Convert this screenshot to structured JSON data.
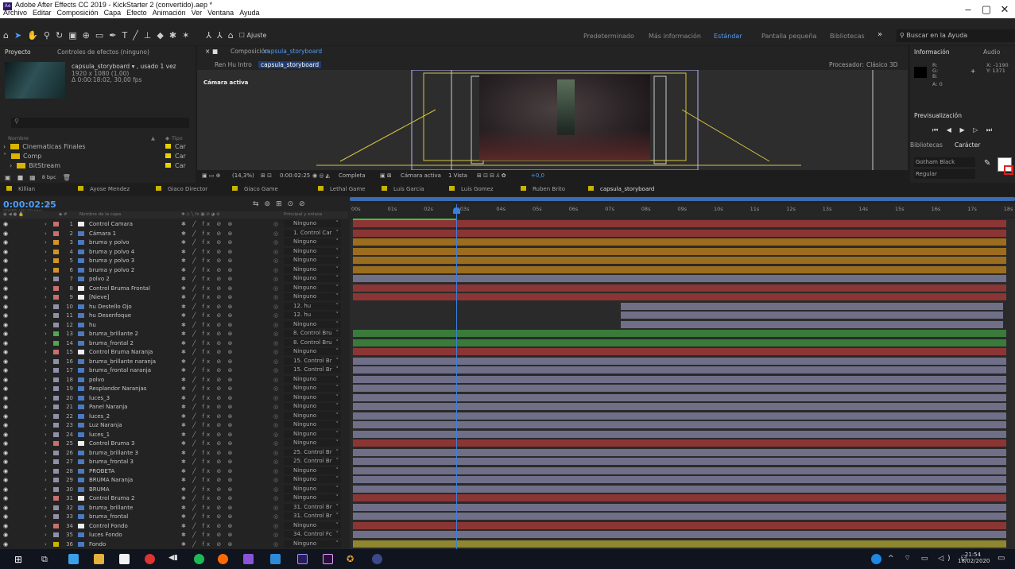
{
  "window": {
    "title": "Adobe After Effects CC 2019 - KickStarter 2 (convertido).aep *",
    "app_badge": "Ae",
    "menu": [
      "Archivo",
      "Editar",
      "Composición",
      "Capa",
      "Efecto",
      "Animación",
      "Ver",
      "Ventana",
      "Ayuda"
    ],
    "controls": {
      "minimize": "–",
      "maximize": "▢",
      "close": "✕"
    }
  },
  "toolbar": {
    "snap_label": "Ajuste",
    "workspaces": [
      "Predeterminado",
      "Más información",
      "Estándar",
      "Pantalla pequeña",
      "Bibliotecas"
    ],
    "active_workspace": "Estándar",
    "more": "»",
    "search_placeholder": "Buscar en la Ayuda"
  },
  "project_panel": {
    "tab1": "Proyecto",
    "tab2": "Controles de efectos (ninguno)",
    "item_name": "capsula_storyboard ▾ , usado 1 vez",
    "item_res": "1920 x 1080 (1,00)",
    "item_dur": "Δ 0:00:18:02, 30,00 fps",
    "col_name": "Nombre",
    "col_type": "Tipo",
    "rows": [
      {
        "name": "Cinematicas Finales",
        "type": "Car"
      },
      {
        "name": "Comp",
        "type": "Car"
      },
      {
        "name": "BitStream",
        "type": "Car"
      }
    ],
    "bpc": "8 bpc"
  },
  "composition": {
    "tab": "Composición",
    "comp_name": "capsula_storyboard",
    "breadcrumb_1": "Ren Hu Intro",
    "breadcrumb_2": "capsula_storyboard",
    "renderer_label": "Procesador:",
    "renderer_value": "Clásico 3D",
    "camera_label": "Cámara activa",
    "footer": {
      "zoom": "(14,3%)",
      "time": "0:00:02:25",
      "resolution": "Completa",
      "view": "Cámara activa",
      "views": "1 Vista",
      "exposure": "+0,0"
    }
  },
  "info_panel": {
    "tab1": "Información",
    "tab2": "Audio",
    "r": "R:",
    "g": "G:",
    "b": "B:",
    "a": "A: 0",
    "x": "X: -1190",
    "y": "Y: 1371",
    "preview_tab": "Previsualización",
    "lib_tab": "Bibliotecas",
    "char_tab": "Carácter",
    "font": "Gotham Black",
    "style": "Regular"
  },
  "comp_tabs": [
    "Killian",
    "Ayose Mendez",
    "Giaco Director",
    "Giaco Game",
    "Lethal Game",
    "Luis Garcia",
    "Luis Gomez",
    "Ruben Brito",
    "capsula_storyboard"
  ],
  "comp_tab_colors": [
    "#c9b400",
    "#c9b400",
    "#c9b400",
    "#c9b400",
    "#c9b400",
    "#c9b400",
    "#c9b400",
    "#c9b400",
    "#c9b400"
  ],
  "timeline": {
    "current_time": "0:00:02:25",
    "fps_info": "00085 (30,00 fps)",
    "col_name": "Nombre de la capa",
    "col_parent": "Principal y enlace",
    "ruler": [
      "00s",
      "01s",
      "02s",
      "03s",
      "04s",
      "05s",
      "06s",
      "07s",
      "08s",
      "09s",
      "10s",
      "11s",
      "12s",
      "13s",
      "14s",
      "15s",
      "16s",
      "17s",
      "18s"
    ],
    "layers": [
      {
        "n": "1",
        "name": "Control Camara",
        "label": "#c86f6f",
        "parent": "Ninguno",
        "bar": "#8c3535",
        "start": 0.0,
        "end": 1.0
      },
      {
        "n": "2",
        "name": "Cámara 1",
        "label": "#c86f6f",
        "parent": "1. Control Car",
        "bar": "#8c3535",
        "start": 0.0,
        "end": 1.0
      },
      {
        "n": "3",
        "name": "bruma y polvo",
        "label": "#d29428",
        "parent": "Ninguno",
        "bar": "#9c6d1e",
        "start": 0.0,
        "end": 1.0
      },
      {
        "n": "4",
        "name": "bruma y polvo 4",
        "label": "#d29428",
        "parent": "Ninguno",
        "bar": "#9c6d1e",
        "start": 0.0,
        "end": 1.0
      },
      {
        "n": "5",
        "name": "bruma y polvo 3",
        "label": "#d29428",
        "parent": "Ninguno",
        "bar": "#9c6d1e",
        "start": 0.0,
        "end": 1.0
      },
      {
        "n": "6",
        "name": "bruma y polvo 2",
        "label": "#d29428",
        "parent": "Ninguno",
        "bar": "#9c6d1e",
        "start": 0.0,
        "end": 1.0
      },
      {
        "n": "7",
        "name": "polvo 2",
        "label": "#8f8fa8",
        "parent": "Ninguno",
        "bar": "#6f6f88",
        "start": 0.0,
        "end": 1.0
      },
      {
        "n": "8",
        "name": "Control Bruma Frontal",
        "label": "#c86f6f",
        "parent": "Ninguno",
        "bar": "#8c3535",
        "start": 0.0,
        "end": 1.0
      },
      {
        "n": "9",
        "name": "[Nieve]",
        "label": "#c86f6f",
        "parent": "Ninguno",
        "bar": "#8c3535",
        "start": 0.0,
        "end": 1.0
      },
      {
        "n": "10",
        "name": "hu Destello Ojo",
        "label": "#8f8fa8",
        "parent": "12. hu",
        "bar": "#6f6f88",
        "start": 0.41,
        "end": 0.995
      },
      {
        "n": "11",
        "name": "hu Desenfoque",
        "label": "#8f8fa8",
        "parent": "12. hu",
        "bar": "#6f6f88",
        "start": 0.41,
        "end": 0.995
      },
      {
        "n": "12",
        "name": "hu",
        "label": "#8f8fa8",
        "parent": "Ninguno",
        "bar": "#6f6f88",
        "start": 0.41,
        "end": 0.995
      },
      {
        "n": "13",
        "name": "bruma_brillante 2",
        "label": "#4fa64f",
        "parent": "8. Control Bru",
        "bar": "#3a7a3a",
        "start": 0.0,
        "end": 1.0
      },
      {
        "n": "14",
        "name": "bruma_frontal 2",
        "label": "#4fa64f",
        "parent": "8. Control Bru",
        "bar": "#3a7a3a",
        "start": 0.0,
        "end": 1.0
      },
      {
        "n": "15",
        "name": "Control Bruma Naranja",
        "label": "#c86f6f",
        "parent": "Ninguno",
        "bar": "#8c3535",
        "start": 0.0,
        "end": 1.0
      },
      {
        "n": "16",
        "name": "bruma_brillante naranja",
        "label": "#8f8fa8",
        "parent": "15. Control Br",
        "bar": "#6f6f88",
        "start": 0.0,
        "end": 1.0
      },
      {
        "n": "17",
        "name": "bruma_frontal naranja",
        "label": "#8f8fa8",
        "parent": "15. Control Br",
        "bar": "#6f6f88",
        "start": 0.0,
        "end": 1.0
      },
      {
        "n": "18",
        "name": "polvo",
        "label": "#8f8fa8",
        "parent": "Ninguno",
        "bar": "#6f6f88",
        "start": 0.0,
        "end": 1.0
      },
      {
        "n": "19",
        "name": "Resplandor Naranjas",
        "label": "#8f8fa8",
        "parent": "Ninguno",
        "bar": "#6f6f88",
        "start": 0.0,
        "end": 1.0
      },
      {
        "n": "20",
        "name": "luces_3",
        "label": "#8f8fa8",
        "parent": "Ninguno",
        "bar": "#6f6f88",
        "start": 0.0,
        "end": 1.0
      },
      {
        "n": "21",
        "name": "Panel Naranja",
        "label": "#8f8fa8",
        "parent": "Ninguno",
        "bar": "#6f6f88",
        "start": 0.0,
        "end": 1.0
      },
      {
        "n": "22",
        "name": "luces_2",
        "label": "#8f8fa8",
        "parent": "Ninguno",
        "bar": "#6f6f88",
        "start": 0.0,
        "end": 1.0
      },
      {
        "n": "23",
        "name": "Luz Naranja",
        "label": "#8f8fa8",
        "parent": "Ninguno",
        "bar": "#6f6f88",
        "start": 0.0,
        "end": 1.0
      },
      {
        "n": "24",
        "name": "luces_1",
        "label": "#8f8fa8",
        "parent": "Ninguno",
        "bar": "#6f6f88",
        "start": 0.0,
        "end": 1.0
      },
      {
        "n": "25",
        "name": "Control Bruma 3",
        "label": "#c86f6f",
        "parent": "Ninguno",
        "bar": "#8c3535",
        "start": 0.0,
        "end": 1.0
      },
      {
        "n": "26",
        "name": "bruma_brillante 3",
        "label": "#8f8fa8",
        "parent": "25. Control Br",
        "bar": "#6f6f88",
        "start": 0.0,
        "end": 1.0
      },
      {
        "n": "27",
        "name": "bruma_frontal 3",
        "label": "#8f8fa8",
        "parent": "25. Control Br",
        "bar": "#6f6f88",
        "start": 0.0,
        "end": 1.0
      },
      {
        "n": "28",
        "name": "PROBETA",
        "label": "#8f8fa8",
        "parent": "Ninguno",
        "bar": "#6f6f88",
        "start": 0.0,
        "end": 1.0
      },
      {
        "n": "29",
        "name": "BRUMA Naranja",
        "label": "#8f8fa8",
        "parent": "Ninguno",
        "bar": "#6f6f88",
        "start": 0.0,
        "end": 1.0
      },
      {
        "n": "30",
        "name": "BRUMA",
        "label": "#8f8fa8",
        "parent": "Ninguno",
        "bar": "#6f6f88",
        "start": 0.0,
        "end": 1.0
      },
      {
        "n": "31",
        "name": "Control Bruma 2",
        "label": "#c86f6f",
        "parent": "Ninguno",
        "bar": "#8c3535",
        "start": 0.0,
        "end": 1.0
      },
      {
        "n": "32",
        "name": "bruma_brillante",
        "label": "#8f8fa8",
        "parent": "31. Control Br",
        "bar": "#6f6f88",
        "start": 0.0,
        "end": 1.0
      },
      {
        "n": "33",
        "name": "bruma_frontal",
        "label": "#8f8fa8",
        "parent": "31. Control Br",
        "bar": "#6f6f88",
        "start": 0.0,
        "end": 1.0
      },
      {
        "n": "34",
        "name": "Control Fondo",
        "label": "#c86f6f",
        "parent": "Ninguno",
        "bar": "#8c3535",
        "start": 0.0,
        "end": 1.0
      },
      {
        "n": "35",
        "name": "luces Fondo",
        "label": "#8f8fa8",
        "parent": "34. Control Fc",
        "bar": "#6f6f88",
        "start": 0.0,
        "end": 1.0
      },
      {
        "n": "36",
        "name": "Fondo",
        "label": "#c9b400",
        "parent": "Ninguno",
        "bar": "#8f8730",
        "start": 0.0,
        "end": 1.0
      }
    ]
  },
  "taskbar": {
    "clock_time": "21:54",
    "clock_date": "18/02/2020"
  }
}
